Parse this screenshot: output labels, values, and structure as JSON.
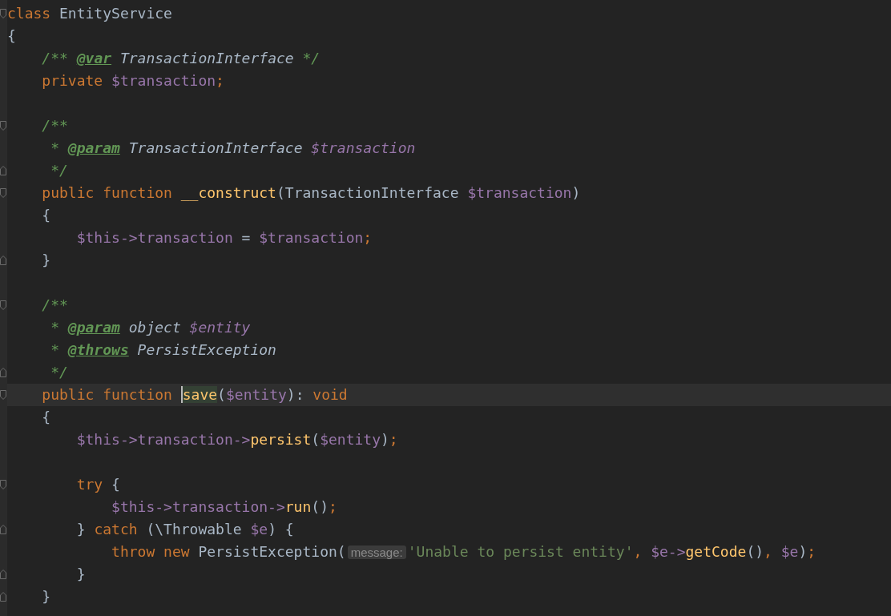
{
  "editor": {
    "lines": [
      {
        "fold_start": true,
        "fold_end": false,
        "current": false,
        "tokens": [
          {
            "kind": "keyword",
            "text": "class"
          },
          {
            "kind": "plain",
            "text": " EntityService"
          }
        ]
      },
      {
        "fold_start": false,
        "fold_end": false,
        "current": false,
        "tokens": [
          {
            "kind": "plain",
            "text": "{"
          }
        ]
      },
      {
        "fold_start": false,
        "fold_end": false,
        "current": false,
        "tokens": [
          {
            "kind": "comment",
            "text": "    /** "
          },
          {
            "kind": "doctag",
            "text": "@var"
          },
          {
            "kind": "doctype",
            "text": " TransactionInterface"
          },
          {
            "kind": "comment",
            "text": " */"
          }
        ]
      },
      {
        "fold_start": false,
        "fold_end": false,
        "current": false,
        "tokens": [
          {
            "kind": "keyword",
            "text": "    private"
          },
          {
            "kind": "variable",
            "text": " $transaction"
          },
          {
            "kind": "keyword",
            "text": ";"
          }
        ]
      },
      {
        "fold_start": false,
        "fold_end": false,
        "current": false
      },
      {
        "fold_start": true,
        "fold_end": false,
        "current": false,
        "tokens": [
          {
            "kind": "comment",
            "text": "    /**"
          }
        ]
      },
      {
        "fold_start": false,
        "fold_end": false,
        "current": false,
        "tokens": [
          {
            "kind": "comment",
            "text": "     * "
          },
          {
            "kind": "doctag",
            "text": "@param"
          },
          {
            "kind": "doctype",
            "text": " TransactionInterface"
          },
          {
            "kind": "docvar",
            "text": " $transaction"
          }
        ]
      },
      {
        "fold_start": false,
        "fold_end": true,
        "current": false,
        "tokens": [
          {
            "kind": "comment",
            "text": "     */"
          }
        ]
      },
      {
        "fold_start": true,
        "fold_end": false,
        "current": false,
        "tokens": [
          {
            "kind": "keyword",
            "text": "    public function"
          },
          {
            "kind": "function",
            "text": " __construct"
          },
          {
            "kind": "plain",
            "text": "(TransactionInterface "
          },
          {
            "kind": "variable",
            "text": "$transaction"
          },
          {
            "kind": "plain",
            "text": ")"
          }
        ]
      },
      {
        "fold_start": false,
        "fold_end": false,
        "current": false,
        "tokens": [
          {
            "kind": "plain",
            "text": "    {"
          }
        ]
      },
      {
        "fold_start": false,
        "fold_end": false,
        "current": false,
        "tokens": [
          {
            "kind": "variable",
            "text": "        $this->transaction"
          },
          {
            "kind": "plain",
            "text": " = "
          },
          {
            "kind": "variable",
            "text": "$transaction"
          },
          {
            "kind": "keyword",
            "text": ";"
          }
        ]
      },
      {
        "fold_start": false,
        "fold_end": true,
        "current": false,
        "tokens": [
          {
            "kind": "plain",
            "text": "    }"
          }
        ]
      },
      {
        "fold_start": false,
        "fold_end": false,
        "current": false
      },
      {
        "fold_start": true,
        "fold_end": false,
        "current": false,
        "tokens": [
          {
            "kind": "comment",
            "text": "    /**"
          }
        ]
      },
      {
        "fold_start": false,
        "fold_end": false,
        "current": false,
        "tokens": [
          {
            "kind": "comment",
            "text": "     * "
          },
          {
            "kind": "doctag",
            "text": "@param"
          },
          {
            "kind": "doctype",
            "text": " object"
          },
          {
            "kind": "docvar",
            "text": " $entity"
          }
        ]
      },
      {
        "fold_start": false,
        "fold_end": false,
        "current": false,
        "tokens": [
          {
            "kind": "comment",
            "text": "     * "
          },
          {
            "kind": "doctag",
            "text": "@throws"
          },
          {
            "kind": "doctype",
            "text": " PersistException"
          }
        ]
      },
      {
        "fold_start": false,
        "fold_end": true,
        "current": false,
        "tokens": [
          {
            "kind": "comment",
            "text": "     */"
          }
        ]
      },
      {
        "fold_start": true,
        "fold_end": false,
        "current": true,
        "tokens": [
          {
            "kind": "keyword",
            "text": "    public function "
          },
          {
            "kind": "usage",
            "text": "save"
          },
          {
            "kind": "plain",
            "text": "("
          },
          {
            "kind": "variable",
            "text": "$entity"
          },
          {
            "kind": "plain",
            "text": "): "
          },
          {
            "kind": "keyword",
            "text": "void"
          }
        ]
      },
      {
        "fold_start": false,
        "fold_end": false,
        "current": false,
        "tokens": [
          {
            "kind": "plain",
            "text": "    {"
          }
        ]
      },
      {
        "fold_start": false,
        "fold_end": false,
        "current": false,
        "tokens": [
          {
            "kind": "variable",
            "text": "        $this->transaction->"
          },
          {
            "kind": "function",
            "text": "persist"
          },
          {
            "kind": "plain",
            "text": "("
          },
          {
            "kind": "variable",
            "text": "$entity"
          },
          {
            "kind": "plain",
            "text": ")"
          },
          {
            "kind": "keyword",
            "text": ";"
          }
        ]
      },
      {
        "fold_start": false,
        "fold_end": false,
        "current": false
      },
      {
        "fold_start": true,
        "fold_end": false,
        "current": false,
        "tokens": [
          {
            "kind": "keyword",
            "text": "        try"
          },
          {
            "kind": "plain",
            "text": " {"
          }
        ]
      },
      {
        "fold_start": false,
        "fold_end": false,
        "current": false,
        "tokens": [
          {
            "kind": "variable",
            "text": "            $this->transaction->"
          },
          {
            "kind": "function",
            "text": "run"
          },
          {
            "kind": "plain",
            "text": "()"
          },
          {
            "kind": "keyword",
            "text": ";"
          }
        ]
      },
      {
        "fold_start": false,
        "fold_end": true,
        "current": false,
        "tokens": [
          {
            "kind": "plain",
            "text": "        } "
          },
          {
            "kind": "keyword",
            "text": "catch"
          },
          {
            "kind": "plain",
            "text": " (\\Throwable "
          },
          {
            "kind": "variable",
            "text": "$e"
          },
          {
            "kind": "plain",
            "text": ") {"
          }
        ]
      },
      {
        "fold_start": false,
        "fold_end": false,
        "current": false,
        "tokens": [
          {
            "kind": "keyword",
            "text": "            throw new"
          },
          {
            "kind": "plain",
            "text": " PersistException("
          },
          {
            "kind": "hint",
            "text": "message:"
          },
          {
            "kind": "string",
            "text": "'Unable to persist entity'"
          },
          {
            "kind": "keyword",
            "text": ", "
          },
          {
            "kind": "variable",
            "text": "$e->"
          },
          {
            "kind": "function",
            "text": "getCode"
          },
          {
            "kind": "plain",
            "text": "()"
          },
          {
            "kind": "keyword",
            "text": ", "
          },
          {
            "kind": "variable",
            "text": "$e"
          },
          {
            "kind": "plain",
            "text": ")"
          },
          {
            "kind": "keyword",
            "text": ";"
          }
        ]
      },
      {
        "fold_start": false,
        "fold_end": true,
        "current": false,
        "tokens": [
          {
            "kind": "plain",
            "text": "        }"
          }
        ]
      },
      {
        "fold_start": false,
        "fold_end": true,
        "current": false,
        "tokens": [
          {
            "kind": "plain",
            "text": "    }"
          }
        ]
      }
    ]
  }
}
